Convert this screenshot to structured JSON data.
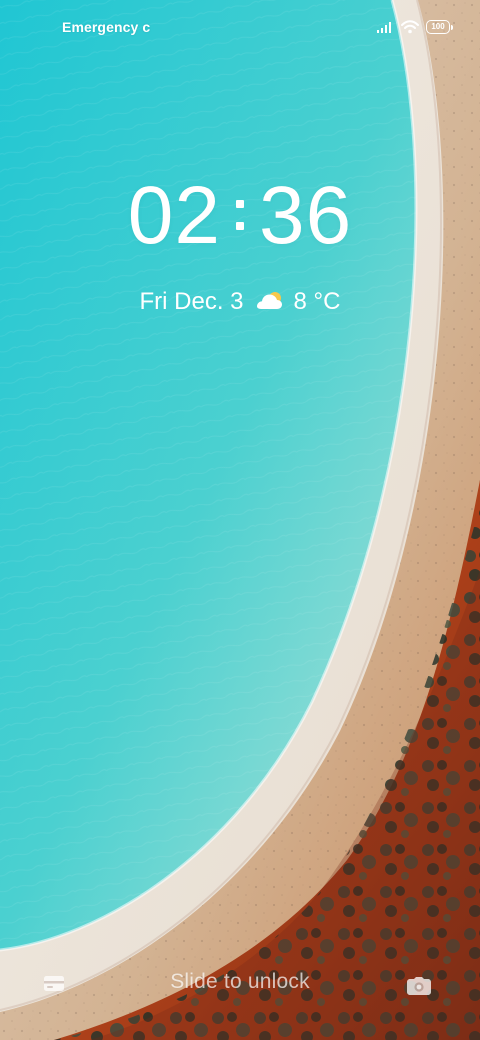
{
  "status_bar": {
    "carrier_text": "Emergency c",
    "battery_level": "100",
    "icons": [
      "signal-icon",
      "wifi-icon",
      "battery-icon"
    ]
  },
  "lock_screen": {
    "hour": "02",
    "minute": "36",
    "date": "Fri Dec. 3",
    "weather_icon": "partly-cloudy-icon",
    "temperature": "8 °C",
    "slide_text": "Slide to unlock",
    "left_shortcut_icon": "card-icon",
    "right_shortcut_icon": "camera-icon"
  },
  "colors": {
    "water": "#2ec7cf",
    "sand": "#d7b796",
    "earth": "#b84b1f",
    "text": "#ffffff"
  }
}
